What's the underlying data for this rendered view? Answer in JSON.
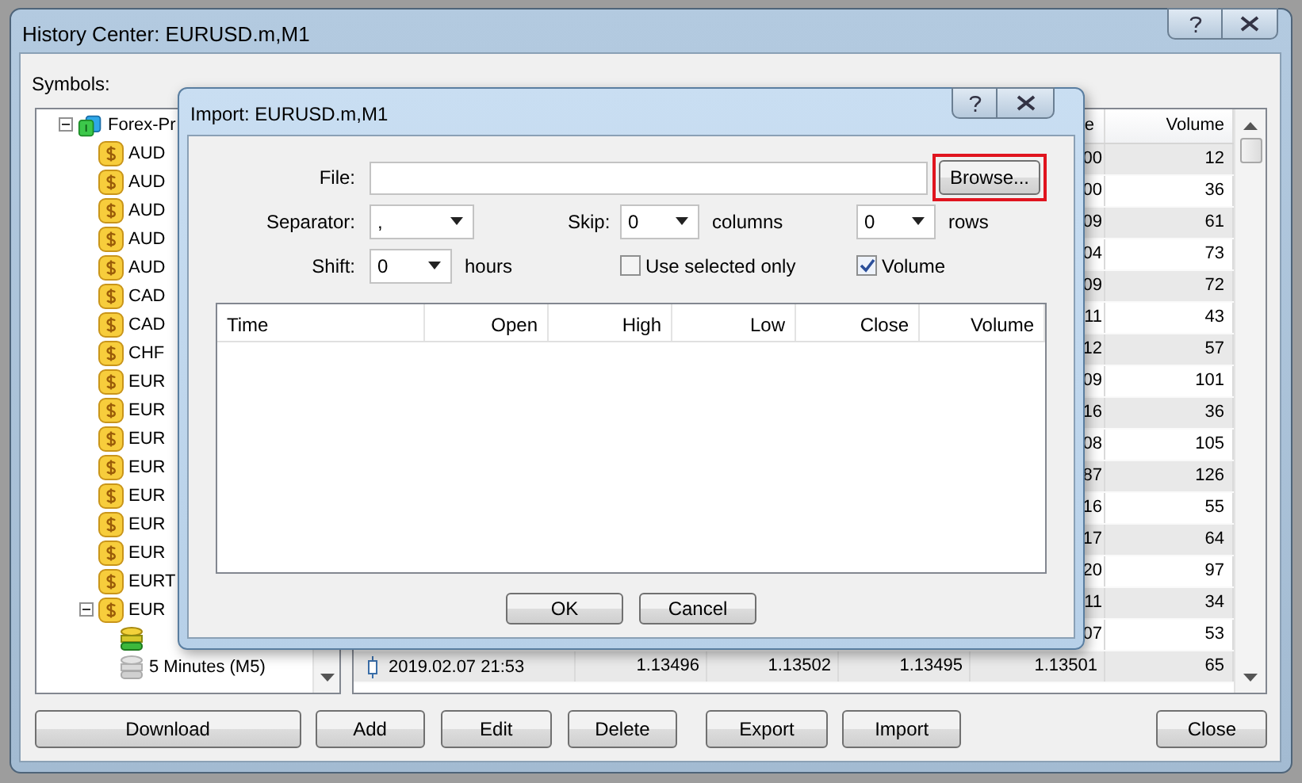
{
  "window": {
    "title": "History Center: EURUSD.m,M1"
  },
  "symbols_label": "Symbols:",
  "tree": {
    "label": "Forex-Pr",
    "expanded": true,
    "children": [
      {
        "label": "AUD"
      },
      {
        "label": "AUD"
      },
      {
        "label": "AUD"
      },
      {
        "label": "AUD"
      },
      {
        "label": "AUD"
      },
      {
        "label": "CAD"
      },
      {
        "label": "CAD"
      },
      {
        "label": "CHF"
      },
      {
        "label": "EUR"
      },
      {
        "label": "EUR"
      },
      {
        "label": "EUR"
      },
      {
        "label": "EUR"
      },
      {
        "label": "EUR"
      },
      {
        "label": "EUR"
      },
      {
        "label": "EUR"
      },
      {
        "label": "EURT"
      },
      {
        "label": "EUR",
        "expanded": true,
        "children": [
          {
            "kind": "timeframe",
            "has_data": true
          },
          {
            "kind": "timeframe",
            "has_data": false,
            "label": "5 Minutes (M5)"
          }
        ]
      }
    ]
  },
  "history_table": {
    "headers": {
      "close": "e",
      "volume": "Volume"
    },
    "rows": [
      {
        "close": "00",
        "volume": "12"
      },
      {
        "close": "00",
        "volume": "36"
      },
      {
        "close": "09",
        "volume": "61"
      },
      {
        "close": "04",
        "volume": "73"
      },
      {
        "close": "09",
        "volume": "72"
      },
      {
        "close": "11",
        "volume": "43"
      },
      {
        "close": "12",
        "volume": "57"
      },
      {
        "close": "09",
        "volume": "101"
      },
      {
        "close": "16",
        "volume": "36"
      },
      {
        "close": "08",
        "volume": "105"
      },
      {
        "close": "87",
        "volume": "126"
      },
      {
        "close": "16",
        "volume": "55"
      },
      {
        "close": "17",
        "volume": "64"
      },
      {
        "close": "20",
        "volume": "97"
      },
      {
        "close": "11",
        "volume": "34"
      },
      {
        "close": "07",
        "volume": "53"
      },
      {
        "time": "2019.02.07 21:53",
        "open": "1.13496",
        "high": "1.13502",
        "low": "1.13495",
        "close": "1.13501",
        "volume": "65"
      }
    ]
  },
  "buttons": [
    "Download",
    "Add",
    "Edit",
    "Delete",
    "Export",
    "Import",
    "Close"
  ],
  "import_dialog": {
    "title": "Import: EURUSD.m,M1",
    "file": {
      "label": "File:"
    },
    "browse": {
      "label": "Browse...",
      "highlighted": true
    },
    "separator": {
      "label": "Separator:",
      "value": ","
    },
    "skip": {
      "label": "Skip:",
      "columns_value": "0",
      "columns_unit": "columns",
      "rows_value": "0",
      "rows_unit": "rows"
    },
    "shift": {
      "label": "Shift:",
      "value": "0",
      "unit": "hours"
    },
    "checkboxes": [
      {
        "label": "Use selected only",
        "checked": false
      },
      {
        "label": "Volume",
        "checked": true
      }
    ],
    "table_columns": [
      "Time",
      "Open",
      "High",
      "Low",
      "Close",
      "Volume"
    ],
    "buttons": [
      "OK",
      "Cancel"
    ]
  }
}
